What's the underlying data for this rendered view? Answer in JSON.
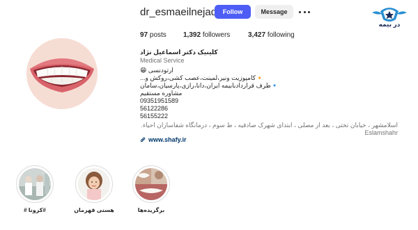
{
  "profile": {
    "username": "dr_esmaeilnejad",
    "follow_label": "Follow",
    "message_label": "Message",
    "stats": {
      "posts_count": "97",
      "posts_label": "posts",
      "followers_count": "1,392",
      "followers_label": "followers",
      "following_count": "3,427",
      "following_label": "following"
    },
    "bio": {
      "name": "کلینیک دکتر اسماعیل نژاد",
      "category": "Medical Service",
      "lines": [
        "ارتودنسی 😁",
        "🔸کامپوزیت ونیر،لمینت،عصب کشی،روکش و...",
        "🔹طرف قراردادبابیمه ایران،دانا،رازی،پارسیان،سامان",
        "مشاوره مستقیم",
        "09351951589",
        "56122286",
        "56155222"
      ],
      "address": "اسلامشهر ، خیابان تختی ، بعد از مصلی ، ابتدای شهرک صادقیه ، ط سوم ، درمانگاه شفاسازان احیاء.",
      "city": "Eslamshahr",
      "link": "www.shafy.ir"
    }
  },
  "logo": {
    "text": "در بیمه",
    "accent_color": "#1c2d5a"
  },
  "highlights": [
    {
      "label": "#کرونا #"
    },
    {
      "label": "هستی قهرمان"
    },
    {
      "label": "برگزیده‌ها"
    }
  ],
  "colors": {
    "follow_button": "#4d5df5",
    "message_button": "#efefef",
    "link": "#00376b",
    "muted_text": "#737373"
  }
}
